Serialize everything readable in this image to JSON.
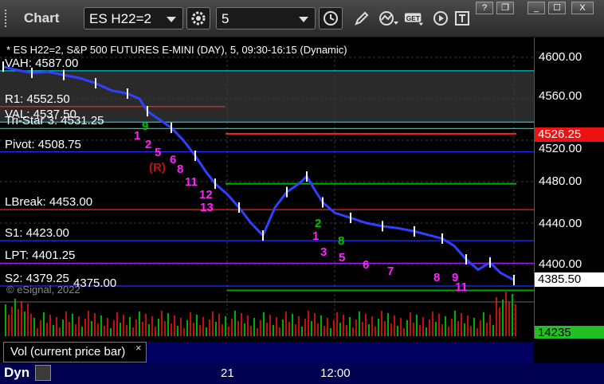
{
  "window": {
    "title": "Chart",
    "symbol": "ES H22=2",
    "interval": "5",
    "controls": [
      "?",
      "❐",
      "_",
      "☐",
      "X"
    ]
  },
  "toolbar_icons": [
    "gear-icon",
    "clock-icon",
    "pencil-icon",
    "study-icon",
    "get-icon",
    "play-icon",
    "text-icon"
  ],
  "chart": {
    "header": "* ES H22=2, S&P 500 FUTURES E-MINI (DAY), 5, 09:30-16:15 (Dynamic)",
    "copyright": "© eSignal, 2022",
    "last_price": "4526.25",
    "cursor_price": "4385.50",
    "volume_value": "14235",
    "price_ticks": [
      "4600.00",
      "4560.00",
      "4520.00",
      "4480.00",
      "4440.00",
      "4400.00"
    ],
    "time_ticks": [
      "21",
      "12:00"
    ],
    "levels": [
      {
        "label": "VAH: 4587.00",
        "price": 4587.0,
        "color": "#00c8c8"
      },
      {
        "label": "R1: 4552.50",
        "price": 4552.5,
        "color": "#ff2020"
      },
      {
        "label": "VAL: 4537.50",
        "price": 4537.5,
        "color": "#00c8c8"
      },
      {
        "label": "Tri-Star 3: 4531.25",
        "price": 4531.25,
        "color": "#00c8c8"
      },
      {
        "label": "Pivot: 4508.75",
        "price": 4508.75,
        "color": "#2a2aff"
      },
      {
        "label": "LBreak: 4453.00",
        "price": 4453.0,
        "color": "#ff2020"
      },
      {
        "label": "S1: 4423.00",
        "price": 4423.0,
        "color": "#2a2aff"
      },
      {
        "label": "LPT: 4401.25",
        "price": 4401.25,
        "color": "#a020f0"
      },
      {
        "label": "S2: 4379.25",
        "price": 4379.25,
        "color": "#2a2aff"
      },
      {
        "label": "4375.00",
        "price": 4375.0,
        "color": "#00a000"
      }
    ],
    "counts": [
      {
        "text": "1",
        "color": "#ff22ff"
      },
      {
        "text": "2",
        "color": "#ff22ff"
      },
      {
        "text": "5",
        "color": "#ff22ff"
      },
      {
        "text": "6",
        "color": "#ff22ff"
      },
      {
        "text": "8",
        "color": "#ff22ff"
      },
      {
        "text": "11",
        "color": "#ff22ff"
      },
      {
        "text": "12",
        "color": "#ff22ff"
      },
      {
        "text": "13",
        "color": "#ff22ff"
      },
      {
        "text": "(R)",
        "color": "#c01010"
      },
      {
        "text": "1",
        "color": "#ff22ff"
      },
      {
        "text": "3",
        "color": "#ff22ff"
      },
      {
        "text": "5",
        "color": "#ff22ff"
      },
      {
        "text": "6",
        "color": "#ff22ff"
      },
      {
        "text": "7",
        "color": "#ff22ff"
      },
      {
        "text": "8",
        "color": "#ff22ff"
      },
      {
        "text": "9",
        "color": "#ff22ff"
      },
      {
        "text": "11",
        "color": "#ff22ff"
      },
      {
        "text": "2",
        "color": "#00c000"
      },
      {
        "text": "9",
        "color": "#00c000"
      },
      {
        "text": "8",
        "color": "#00c000"
      }
    ]
  },
  "volume_panel": {
    "label": "Vol (current price bar)",
    "close": "×"
  },
  "footer": {
    "mode": "Dyn"
  }
}
